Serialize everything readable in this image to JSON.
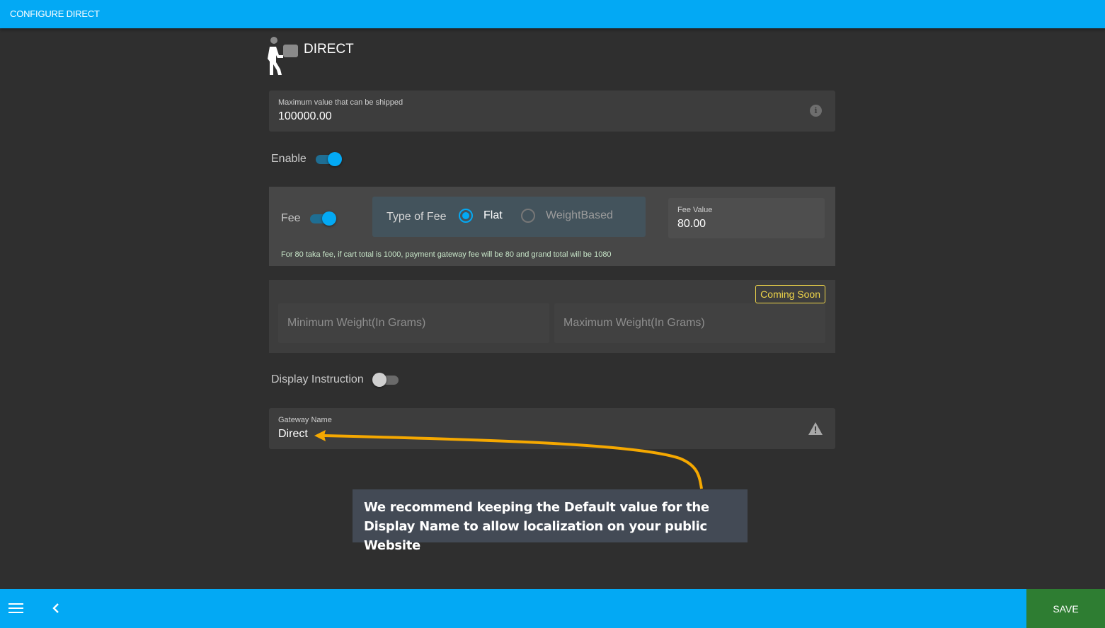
{
  "topbar": {
    "title": "CONFIGURE DIRECT"
  },
  "header": {
    "icon": "person-carrying-box-icon",
    "title": "DIRECT"
  },
  "max_value": {
    "label": "Maximum value that can be shipped",
    "value": "100000.00",
    "icon": "info-icon",
    "icon_glyph": "i"
  },
  "enable": {
    "label": "Enable",
    "on": true
  },
  "fee": {
    "label": "Fee",
    "on": true,
    "type_label": "Type of Fee",
    "options": [
      {
        "label": "Flat",
        "selected": true
      },
      {
        "label": "WeightBased",
        "selected": false
      }
    ],
    "value_label": "Fee Value",
    "value": "80.00",
    "note": "For 80 taka fee, if cart total is 1000, payment gateway fee will be 80 and grand total will be 1080"
  },
  "weight": {
    "badge": "Coming Soon",
    "min_placeholder": "Minimum Weight(In Grams)",
    "max_placeholder": "Maximum Weight(In Grams)"
  },
  "display_instruction": {
    "label": "Display Instruction",
    "on": false
  },
  "gateway_name": {
    "label": "Gateway Name",
    "value": "Direct",
    "icon": "warning-icon"
  },
  "callout": {
    "text": "We recommend keeping the Default value for the Display Name to allow localization on your public Website",
    "arrow_color": "#f5a800"
  },
  "bottombar": {
    "menu_icon": "hamburger-menu-icon",
    "back_icon": "chevron-left-icon",
    "save_label": "SAVE"
  },
  "colors": {
    "accent": "#03a9f4",
    "save": "#2e7d32",
    "badge": "#f0d64a",
    "background": "#2f2f2f"
  }
}
